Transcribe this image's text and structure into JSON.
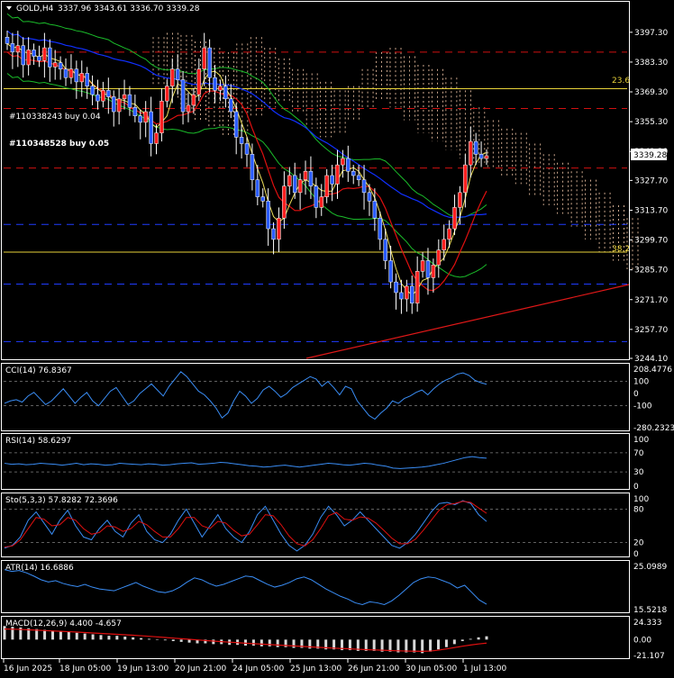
{
  "symbol_title": "GOLD,H4",
  "ohlc_text": "3337.96 3343.61 3336.70 3339.28",
  "current_price": "3339.28",
  "colors": {
    "background": "#000000",
    "frame": "#ffffff",
    "grid": "#808080",
    "bull": "#ff2020",
    "bear": "#2a5cff",
    "ichimoku_cloud": "#ffd1b0",
    "fib_line": "#e8d23a",
    "trend_line": "#e01818",
    "red_dash": "#d01010",
    "blue_dash": "#1f3cff",
    "bollinger": "#1abb2a",
    "ma_blue": "#1030ff",
    "ma_red": "#e01010",
    "ma_yellow": "#f0e05a",
    "indicator_line": "#3a8df5",
    "signal_red": "#e01010",
    "text": "#ffffff"
  },
  "annotations": {
    "order1": "#110338243 buy 0.04",
    "order2": "#110348528 buy 0.05",
    "fib_236": "23.6",
    "fib_382": "38.2"
  },
  "price_axis": {
    "labels": [
      "3397.30",
      "3383.30",
      "3369.30",
      "3355.30",
      "3341.30",
      "3327.70",
      "3313.70",
      "3299.70",
      "3285.70",
      "3271.70",
      "3257.70",
      "3244.10"
    ],
    "range": [
      3244.1,
      3404.0
    ]
  },
  "time_axis": {
    "labels": [
      "16 Jun 2025",
      "18 Jun 05:00",
      "19 Jun 13:00",
      "20 Jun 21:00",
      "24 Jun 05:00",
      "25 Jun 13:00",
      "26 Jun 21:00",
      "30 Jun 05:00",
      "1 Jul 13:00"
    ]
  },
  "chart_data": [
    {
      "type": "candlestick",
      "title": "GOLD,H4",
      "y_range": [
        3244.1,
        3404.0
      ],
      "x_ticks": [
        "16 Jun 2025",
        "18 Jun 05:00",
        "19 Jun 13:00",
        "20 Jun 21:00",
        "24 Jun 05:00",
        "25 Jun 13:00",
        "26 Jun 21:00",
        "30 Jun 05:00",
        "1 Jul 13:00"
      ],
      "candles_close": [
        3392,
        3388,
        3391,
        3382,
        3389,
        3386,
        3384,
        3390,
        3381,
        3383,
        3380,
        3376,
        3380,
        3374,
        3378,
        3372,
        3368,
        3365,
        3370,
        3367,
        3360,
        3366,
        3368,
        3362,
        3358,
        3355,
        3360,
        3345,
        3350,
        3365,
        3372,
        3380,
        3375,
        3360,
        3363,
        3368,
        3380,
        3390,
        3376,
        3370,
        3372,
        3366,
        3360,
        3348,
        3345,
        3340,
        3328,
        3320,
        3318,
        3305,
        3300,
        3310,
        3325,
        3330,
        3322,
        3328,
        3332,
        3325,
        3315,
        3320,
        3330,
        3326,
        3335,
        3338,
        3332,
        3330,
        3328,
        3322,
        3318,
        3310,
        3300,
        3290,
        3280,
        3275,
        3272,
        3278,
        3270,
        3285,
        3290,
        3282,
        3288,
        3295,
        3300,
        3305,
        3315,
        3322,
        3335,
        3346,
        3340,
        3338,
        3339.28
      ],
      "fib_levels": [
        {
          "label": "23.6",
          "value": 3370.8
        },
        {
          "label": "38.2",
          "value": 3294.0
        }
      ],
      "horizontal_levels_red": [
        3388.0,
        3361.5,
        3333.5
      ],
      "horizontal_levels_blue": [
        3307.0,
        3279.0,
        3252.0
      ]
    },
    {
      "type": "line",
      "title": "CCI(14) 76.8367",
      "y_ticks": [
        "208.4776",
        "100",
        "0",
        "-100",
        "-280.2323"
      ],
      "y_range": [
        -280.2323,
        208.4776
      ],
      "levels": [
        100,
        -100
      ],
      "series": [
        {
          "values": [
            -80,
            -60,
            -50,
            -70,
            -20,
            10,
            -40,
            -90,
            -60,
            -10,
            40,
            -20,
            -80,
            -30,
            10,
            -60,
            -100,
            -40,
            20,
            50,
            -20,
            -90,
            -60,
            0,
            40,
            80,
            30,
            -20,
            60,
            120,
            180,
            140,
            80,
            20,
            -10,
            -60,
            -120,
            -200,
            -160,
            -60,
            20,
            -20,
            -80,
            -40,
            30,
            60,
            20,
            -30,
            0,
            50,
            80,
            110,
            140,
            120,
            60,
            100,
            50,
            -10,
            60,
            40,
            -60,
            -120,
            -180,
            -210,
            -160,
            -120,
            -60,
            -80,
            -40,
            -20,
            10,
            30,
            -10,
            40,
            80,
            110,
            130,
            160,
            170,
            150,
            110,
            90,
            76.8367
          ]
        }
      ]
    },
    {
      "type": "line",
      "title": "RSI(14) 58.6297",
      "y_ticks": [
        "100",
        "70",
        "30",
        "0"
      ],
      "y_range": [
        0,
        100
      ],
      "levels": [
        70,
        30
      ],
      "series": [
        {
          "values": [
            48,
            46,
            47,
            45,
            46,
            48,
            47,
            46,
            44,
            46,
            48,
            45,
            47,
            46,
            44,
            45,
            48,
            47,
            46,
            45,
            47,
            46,
            44,
            45,
            47,
            48,
            49,
            46,
            47,
            48,
            50,
            49,
            47,
            45,
            43,
            42,
            40,
            41,
            43,
            44,
            42,
            40,
            42,
            44,
            46,
            48,
            47,
            45,
            44,
            46,
            48,
            47,
            44,
            42,
            38,
            37,
            38,
            39,
            40,
            42,
            45,
            48,
            52,
            56,
            60,
            62,
            60,
            58.6297
          ]
        }
      ]
    },
    {
      "type": "line",
      "title": "Sto(5,3,3) 57.8282 72.3696",
      "y_ticks": [
        "100",
        "80",
        "20",
        "0"
      ],
      "y_range": [
        0,
        100
      ],
      "levels": [
        80,
        20
      ],
      "series": [
        {
          "values": [
            10,
            15,
            30,
            60,
            75,
            55,
            35,
            60,
            78,
            50,
            30,
            25,
            45,
            60,
            40,
            30,
            55,
            70,
            40,
            25,
            20,
            35,
            60,
            80,
            55,
            30,
            50,
            70,
            45,
            30,
            20,
            40,
            70,
            85,
            60,
            35,
            15,
            5,
            15,
            35,
            65,
            85,
            70,
            50,
            60,
            75,
            60,
            45,
            30,
            15,
            10,
            20,
            35,
            55,
            75,
            90,
            92,
            88,
            95,
            90,
            70,
            57.8282
          ]
        },
        {
          "values": [
            12,
            14,
            25,
            45,
            65,
            62,
            50,
            52,
            65,
            60,
            45,
            35,
            38,
            50,
            48,
            40,
            45,
            58,
            52,
            40,
            30,
            30,
            45,
            65,
            65,
            50,
            45,
            58,
            55,
            42,
            32,
            35,
            52,
            70,
            68,
            52,
            32,
            18,
            14,
            25,
            45,
            68,
            74,
            62,
            60,
            66,
            64,
            55,
            42,
            28,
            18,
            18,
            26,
            42,
            60,
            78,
            88,
            90,
            94,
            92,
            82,
            72.3696
          ]
        }
      ]
    },
    {
      "type": "line",
      "title": "ATR(14) 16.6886",
      "y_ticks": [
        "25.0989",
        "15.5218"
      ],
      "y_range": [
        15.5218,
        25.0989
      ],
      "series": [
        {
          "values": [
            24.2,
            23.8,
            24.0,
            23.5,
            22.8,
            22.0,
            21.5,
            21.8,
            21.2,
            20.8,
            20.5,
            21.0,
            20.4,
            20.0,
            19.8,
            19.6,
            20.2,
            20.8,
            21.4,
            20.6,
            20.0,
            19.4,
            19.2,
            19.6,
            20.4,
            21.5,
            22.4,
            22.0,
            21.2,
            20.6,
            21.0,
            21.6,
            22.2,
            22.8,
            22.6,
            21.8,
            21.0,
            20.4,
            20.8,
            21.4,
            22.2,
            22.6,
            22.0,
            21.0,
            20.0,
            19.2,
            18.4,
            17.8,
            17.0,
            16.6,
            17.2,
            17.0,
            16.6,
            17.4,
            18.6,
            20.0,
            21.4,
            22.2,
            22.6,
            22.4,
            21.8,
            21.2,
            20.2,
            20.8,
            19.2,
            17.6,
            16.6886
          ]
        }
      ]
    },
    {
      "type": "bar",
      "title": "MACD(12,26,9) 4.400 -4.657",
      "y_ticks": [
        "24.333",
        "0.00",
        "-21.107"
      ],
      "y_range": [
        -21.107,
        24.333
      ],
      "series": [
        {
          "name": "MACD",
          "values": [
            18,
            17,
            16,
            15,
            14,
            13,
            12,
            11,
            10,
            9,
            8,
            7,
            6,
            5,
            5,
            4,
            3,
            2,
            1,
            0,
            -1,
            -2,
            -3,
            -4,
            -5,
            -5,
            -6,
            -6,
            -7,
            -7,
            -8,
            -8,
            -9,
            -9,
            -10,
            -10,
            -11,
            -11,
            -12,
            -12,
            -13,
            -13,
            -14,
            -14,
            -15,
            -15,
            -15,
            -16,
            -16,
            -17,
            -17,
            -17,
            -18,
            -16,
            -13,
            -10,
            -6,
            -2,
            1,
            3,
            4.4
          ]
        },
        {
          "name": "Signal",
          "values": [
            14,
            13.8,
            13.5,
            13,
            12.5,
            12,
            11.5,
            11,
            10.5,
            10,
            9.4,
            8.8,
            8.2,
            7.6,
            7,
            6.4,
            5.8,
            5.1,
            4.4,
            3.6,
            2.8,
            2,
            1.2,
            0.4,
            -0.4,
            -1.2,
            -2,
            -2.7,
            -3.4,
            -4.1,
            -4.8,
            -5.4,
            -6,
            -6.6,
            -7.2,
            -7.8,
            -8.4,
            -9,
            -9.6,
            -10.2,
            -10.8,
            -11.3,
            -11.8,
            -12.3,
            -12.8,
            -13.3,
            -13.7,
            -14.1,
            -14.5,
            -14.9,
            -15.2,
            -15.4,
            -15.6,
            -15.2,
            -14,
            -12.4,
            -10.6,
            -8.8,
            -7.2,
            -5.8,
            -4.657
          ]
        }
      ]
    }
  ]
}
